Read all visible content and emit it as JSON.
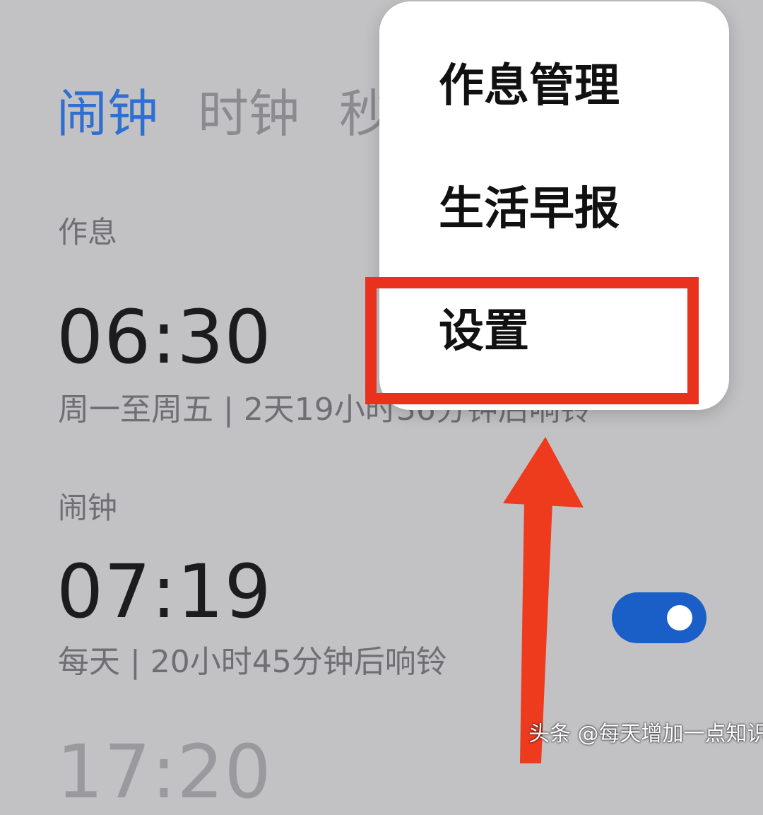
{
  "tabs": [
    {
      "label": "闹钟",
      "active": true
    },
    {
      "label": "时钟",
      "active": false
    },
    {
      "label": "秒",
      "active": false
    }
  ],
  "sections": {
    "sleep": {
      "label": "作息",
      "alarm": {
        "time": "06:30",
        "subtitle": "周一至周五 | 2天19小时36分钟后响铃"
      }
    },
    "alarms": {
      "label": "闹钟",
      "alarm": {
        "time": "07:19",
        "subtitle": "每天 | 20小时45分钟后响铃",
        "enabled": true
      },
      "next_time_partial": "17:20"
    }
  },
  "menu": {
    "items": [
      {
        "label": "作息管理"
      },
      {
        "label": "生活早报"
      },
      {
        "label": "设置",
        "highlighted": true
      }
    ]
  },
  "annotation": {
    "highlight_color": "#e8321e",
    "arrow_color": "#ee3a1d",
    "target": "设置"
  },
  "watermark": "头条 @每天增加一点知识",
  "colors": {
    "accent": "#2f6fd0",
    "toggle_on": "#1a5ec7",
    "background": "#c2c2c5"
  }
}
